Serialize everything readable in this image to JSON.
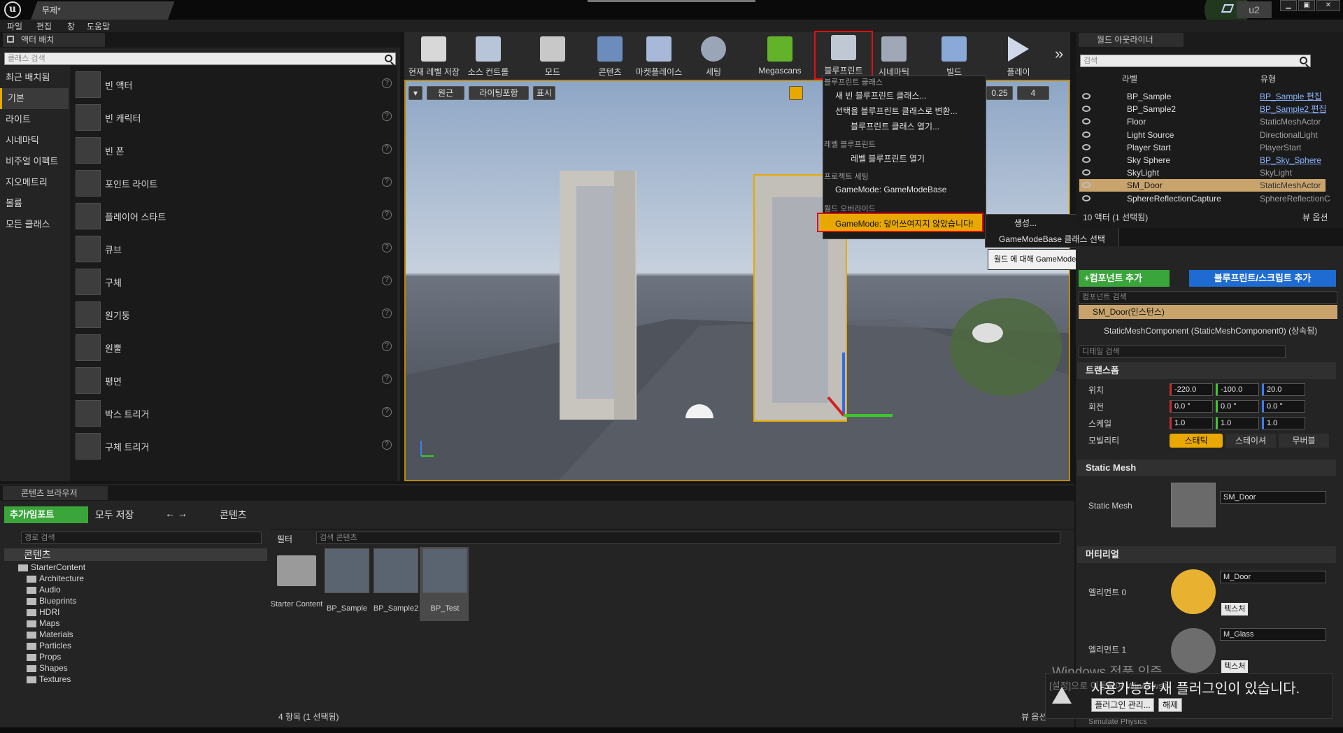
{
  "titlebar": {
    "doc_tab": "무제*",
    "profile": "u2",
    "minimize": "▁",
    "restore": "▣",
    "close": "✕"
  },
  "menubar": [
    "파일",
    "편집",
    "창",
    "도움말"
  ],
  "placement": {
    "tab": "액터 배치",
    "search_placeholder": "클래스 검색",
    "categories": [
      "최근 배치됨",
      "기본",
      "라이트",
      "시네마틱",
      "비주얼 이펙트",
      "지오메트리",
      "볼륨",
      "모든 클래스"
    ],
    "actors": [
      "빈 액터",
      "빈 캐릭터",
      "빈 폰",
      "포인트 라이트",
      "플레이어 스타트",
      "큐브",
      "구체",
      "원기둥",
      "원뿔",
      "평면",
      "박스 트리거",
      "구체 트리거"
    ]
  },
  "toolbar": {
    "save": "현재 레벨 저장",
    "source": "소스 컨트롤",
    "modes": "모드",
    "content": "콘텐츠",
    "marketplace": "마켓플레이스",
    "settings": "세팅",
    "megascans": "Megascans",
    "blueprints": "블루프린트",
    "cinematics": "시네마틱",
    "build": "빌드",
    "play": "플레이",
    "more": "»"
  },
  "viewport": {
    "perspective": "원근",
    "lit": "라이팅포함",
    "show": "표시",
    "snap_scale": "0.25",
    "cam_speed": "4"
  },
  "blueprint_menu": {
    "h1": "블루프린트 클래스",
    "new_class": "새 빈 블루프린트 클래스...",
    "convert": "선택을 블루프린트 클래스로 변환...",
    "open_class": "블루프린트 클래스 열기...",
    "h2": "레벨 블루프린트",
    "open_level": "레벨 블루프린트 열기",
    "h3": "프로젝트 세팅",
    "gamemode": "GameMode: GameModeBase",
    "h4": "월드 오버라이드",
    "override": "GameMode: 덮어쓰여지지 않았습니다!",
    "sub_create": "생성...",
    "sub_select": "GameModeBase 클래스 선택",
    "tooltip": "월드 에 대해 GameModeBase 블루프린트를 선택, 편집, 또는 새로 생성합니다."
  },
  "outliner": {
    "tab": "월드 아웃라이너",
    "search_placeholder": "검색",
    "col_label": "라벨",
    "col_type": "유형",
    "rows": [
      {
        "name": "BP_Sample",
        "type": "BP_Sample 편집",
        "link": true
      },
      {
        "name": "BP_Sample2",
        "type": "BP_Sample2 편집",
        "link": true
      },
      {
        "name": "Floor",
        "type": "StaticMeshActor",
        "link": false
      },
      {
        "name": "Light Source",
        "type": "DirectionalLight",
        "link": false
      },
      {
        "name": "Player Start",
        "type": "PlayerStart",
        "link": false
      },
      {
        "name": "Sky Sphere",
        "type": "BP_Sky_Sphere",
        "link": true
      },
      {
        "name": "SkyLight",
        "type": "SkyLight",
        "link": false
      },
      {
        "name": "SM_Door",
        "type": "StaticMeshActor",
        "link": false
      },
      {
        "name": "SphereReflectionCapture",
        "type": "SphereReflectionC",
        "link": false
      }
    ],
    "status": "10 액터 (1 선택됨)",
    "view_options": "뷰 옵션"
  },
  "details": {
    "add_component": "+컴포넌트 추가",
    "blueprint_script": "블루프린트/스크립트 추가",
    "component_search": "컴포넌트 검색",
    "instance": "SM_Door(인스턴스)",
    "component": "StaticMeshComponent (StaticMeshComponent0) (상속됨)",
    "detail_search": "디테일 검색",
    "transform": "트랜스폼",
    "location": "위치",
    "rotation": "회전",
    "scale": "스케일",
    "mobility": "모빌리티",
    "loc": [
      "-220.0",
      "-100.0",
      "20.0"
    ],
    "rot": [
      "0.0 °",
      "0.0 °",
      "0.0 °"
    ],
    "scl": [
      "1.0",
      "1.0",
      "1.0"
    ],
    "mob_static": "스태틱",
    "mob_stationary": "스테이셔",
    "mob_movable": "무버블",
    "static_mesh_section": "Static Mesh",
    "static_mesh_label": "Static Mesh",
    "static_mesh_value": "SM_Door",
    "materials_section": "머티리얼",
    "element0": "엘리먼트 0",
    "element0_value": "M_Door",
    "element1": "엘리먼트 1",
    "element1_value": "M_Glass",
    "texture": "텍스처",
    "simulate": "Simulate Physics"
  },
  "content_browser": {
    "tab": "콘텐츠 브라우저",
    "add_import": "추가/임포트",
    "save_all": "모두 저장",
    "path": "콘텐츠",
    "path_search": "경로 검색",
    "filter": "필터",
    "content_search": "검색 콘텐츠",
    "tree_root": "콘텐츠",
    "tree": [
      "StarterContent",
      "Architecture",
      "Audio",
      "Blueprints",
      "HDRI",
      "Maps",
      "Materials",
      "Particles",
      "Props",
      "Shapes",
      "Textures"
    ],
    "assets": [
      "Starter Content",
      "BP_Sample",
      "BP_Sample2",
      "BP_Test"
    ],
    "count": "4 항목 (1 선택됨)",
    "view_options": "뷰 옵션"
  },
  "notification": {
    "watermark": "Windows 정품 인증",
    "watermark_sub": "[설정]으로 이동하여 Windows를 정품 인증합니다.",
    "text": "사용가능한 새 플러그인이 있습니다.",
    "manage": "플러그인 관리...",
    "dismiss": "해제"
  },
  "colors": {
    "accent": "#e8a800",
    "selection": "#c8a46c",
    "highlight_red": "#e01010",
    "green_btn": "#3aa53a",
    "blue_btn": "#1e6bd1"
  }
}
